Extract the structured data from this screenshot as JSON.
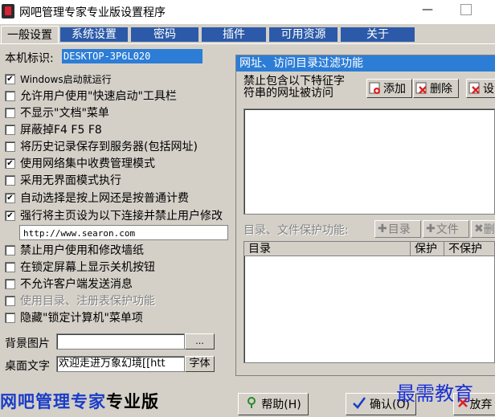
{
  "window": {
    "title": "网吧管理专家专业版设置程序",
    "minimize": "—"
  },
  "tabs": [
    {
      "label": "一般设置"
    },
    {
      "label": "系统设置"
    },
    {
      "label": "密码"
    },
    {
      "label": "插件"
    },
    {
      "label": "可用资源"
    },
    {
      "label": "关于"
    }
  ],
  "general": {
    "machine_id_label": "本机标识:",
    "machine_id_value": "DESKTOP-3P6L020",
    "options": [
      {
        "label": "Windows启动就运行",
        "checked": true
      },
      {
        "label": "允许用户使用\"快速启动\"工具栏",
        "checked": false
      },
      {
        "label": "不显示\"文档\"菜单",
        "checked": false
      },
      {
        "label": "屏蔽掉F4 F5 F8",
        "checked": false
      },
      {
        "label": "将历史记录保存到服务器(包括网址)",
        "checked": false
      },
      {
        "label": "使用网络集中收费管理模式",
        "checked": true
      },
      {
        "label": "采用无界面模式执行",
        "checked": false
      },
      {
        "label": "自动选择是按上网还是按普通计费",
        "checked": true
      },
      {
        "label": "强行将主页设为以下连接并禁止用户修改",
        "checked": true
      },
      {
        "label": "禁止用户使用和修改墙纸",
        "checked": false
      },
      {
        "label": "在锁定屏幕上显示关机按钮",
        "checked": false
      },
      {
        "label": "不允许客户端发送消息",
        "checked": false
      },
      {
        "label": "使用目录、注册表保护功能",
        "checked": false,
        "disabled": true
      },
      {
        "label": "隐藏\"锁定计算机\"菜单项",
        "checked": false
      }
    ],
    "homepage_url": "http://www.searon.com",
    "bg_image_label": "背景图片",
    "bg_browse": "...",
    "desktop_text_label": "桌面文字",
    "desktop_text_value": "欢迎走进万象幻境[[htt",
    "font_button": "字体"
  },
  "url_filter": {
    "header": "网址、访问目录过滤功能",
    "description": "禁止包含以下特征字\n符串的网址被访问",
    "add": "添加",
    "delete": "删除",
    "third": "设"
  },
  "protection": {
    "label": "目录、文件保护功能:",
    "dir_button": "目录",
    "file_button": "文件",
    "delete_button": "删",
    "columns": [
      "目录",
      "保护",
      "不保护"
    ]
  },
  "footer": {
    "brand": "网吧管理专家",
    "brand_suffix": "专业版",
    "help": "帮助(H)",
    "ok": "确认(O)",
    "cancel": "放弃",
    "watermark": "最需教育"
  }
}
